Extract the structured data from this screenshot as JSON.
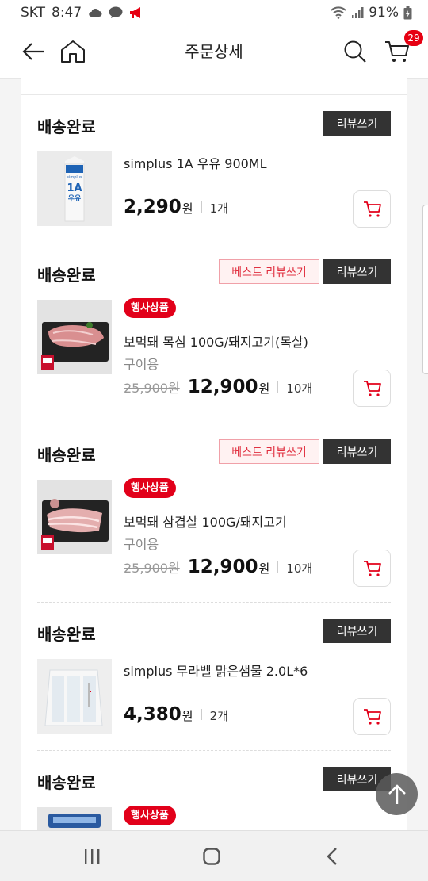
{
  "status_bar": {
    "carrier": "SKT",
    "time": "8:47",
    "battery": "91%"
  },
  "header": {
    "title": "주문상세",
    "cart_count": "29"
  },
  "orders": [
    {
      "status": "배송완료",
      "review_label": "리뷰쓰기",
      "name": "simplus 1A 우유 900ML",
      "price": "2,290",
      "currency": "원",
      "qty": "1개"
    },
    {
      "status": "배송완료",
      "best_review_label": "베스트 리뷰쓰기",
      "review_label": "리뷰쓰기",
      "tag": "행사상품",
      "name": "보먹돼 목심 100G/돼지고기(목살)",
      "sub": "구이용",
      "old_price": "25,900원",
      "price": "12,900",
      "currency": "원",
      "qty": "10개"
    },
    {
      "status": "배송완료",
      "best_review_label": "베스트 리뷰쓰기",
      "review_label": "리뷰쓰기",
      "tag": "행사상품",
      "name": "보먹돼 삼겹살 100G/돼지고기",
      "sub": "구이용",
      "old_price": "25,900원",
      "price": "12,900",
      "currency": "원",
      "qty": "10개"
    },
    {
      "status": "배송완료",
      "review_label": "리뷰쓰기",
      "name": "simplus 무라벨 맑은샘물 2.0L*6",
      "price": "4,380",
      "currency": "원",
      "qty": "2개"
    },
    {
      "status": "배송완료",
      "review_label": "리뷰쓰기",
      "tag": "행사상품"
    }
  ],
  "milk_label": {
    "brand": "simplus",
    "big": "1A",
    "sub": "우유"
  },
  "colors": {
    "accent": "#e2001a",
    "dark_button": "#333333",
    "best_bg": "#fff2f2"
  }
}
